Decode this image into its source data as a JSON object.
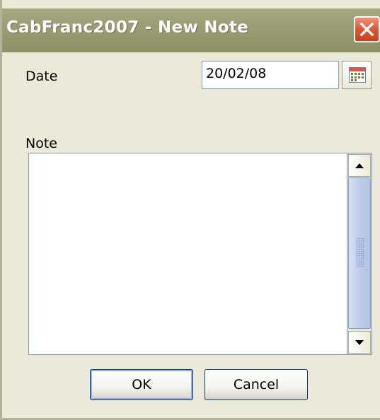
{
  "window": {
    "title": "CabFranc2007 - New Note",
    "close_icon": "close-icon"
  },
  "form": {
    "date_label": "Date",
    "date_value": "20/02/08",
    "calendar_icon": "calendar-icon",
    "note_label": "Note",
    "note_value": ""
  },
  "buttons": {
    "ok_label": "OK",
    "cancel_label": "Cancel"
  },
  "colors": {
    "titlebar": "#9c9c74",
    "dialog_background": "#ece9d8",
    "close_button": "#e0552f",
    "field_border": "#7f9db9"
  }
}
